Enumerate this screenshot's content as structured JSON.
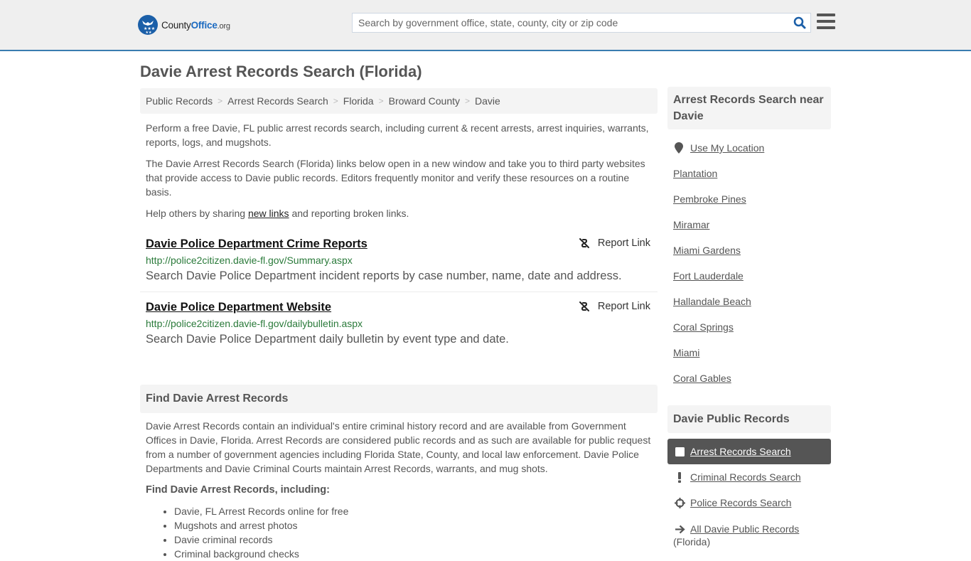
{
  "header": {
    "logo": {
      "county": "County",
      "office": "Office",
      "org": ".org"
    },
    "search": {
      "placeholder": "Search by government office, state, county, city or zip code",
      "value": ""
    },
    "colors": {
      "accent": "#3a7cb0",
      "logo_blue": "#1b5fa8"
    }
  },
  "page": {
    "title": "Davie Arrest Records Search (Florida)"
  },
  "breadcrumb": [
    {
      "label": "Public Records"
    },
    {
      "label": "Arrest Records Search"
    },
    {
      "label": "Florida"
    },
    {
      "label": "Broward County"
    },
    {
      "label": "Davie"
    }
  ],
  "breadcrumb_separator": ">",
  "intro": {
    "p1": "Perform a free Davie, FL public arrest records search, including current & recent arrests, arrest inquiries, warrants, reports, logs, and mugshots.",
    "p2": "The Davie Arrest Records Search (Florida) links below open in a new window and take you to third party websites that provide access to Davie public records. Editors frequently monitor and verify these resources on a routine basis.",
    "p3_before": "Help others by sharing ",
    "p3_link": "new links",
    "p3_after": " and reporting broken links."
  },
  "resources": [
    {
      "title": "Davie Police Department Crime Reports",
      "url": "http://police2citizen.davie-fl.gov/Summary.aspx",
      "description": "Search Davie Police Department incident reports by case number, name, date and address.",
      "report_label": "Report Link"
    },
    {
      "title": "Davie Police Department Website",
      "url": "http://police2citizen.davie-fl.gov/dailybulletin.aspx",
      "description": "Search Davie Police Department daily bulletin by event type and date.",
      "report_label": "Report Link"
    }
  ],
  "find_section": {
    "heading": "Find Davie Arrest Records",
    "body": "Davie Arrest Records contain an individual's entire criminal history record and are available from Government Offices in Davie, Florida. Arrest Records are considered public records and as such are available for public request from a number of government agencies including Florida State, County, and local law enforcement. Davie Police Departments and Davie Criminal Courts maintain Arrest Records, warrants, and mug shots.",
    "subheading": "Find Davie Arrest Records, including:",
    "items": [
      "Davie, FL Arrest Records online for free",
      "Mugshots and arrest photos",
      "Davie criminal records",
      "Criminal background checks"
    ]
  },
  "sidebar": {
    "near_heading": "Arrest Records Search near Davie",
    "use_location": "Use My Location",
    "near_places": [
      "Plantation",
      "Pembroke Pines",
      "Miramar",
      "Miami Gardens",
      "Fort Lauderdale",
      "Hallandale Beach",
      "Coral Springs",
      "Miami",
      "Coral Gables"
    ],
    "public_records_heading": "Davie Public Records",
    "public_records": [
      {
        "label": "Arrest Records Search",
        "icon": "square-icon",
        "active": true
      },
      {
        "label": "Criminal Records Search",
        "icon": "exclamation-icon",
        "active": false
      },
      {
        "label": "Police Records Search",
        "icon": "crosshair-icon",
        "active": false
      },
      {
        "label": "All Davie Public Records",
        "suffix": "(Florida)",
        "icon": "arrow-right-icon",
        "active": false
      }
    ]
  }
}
